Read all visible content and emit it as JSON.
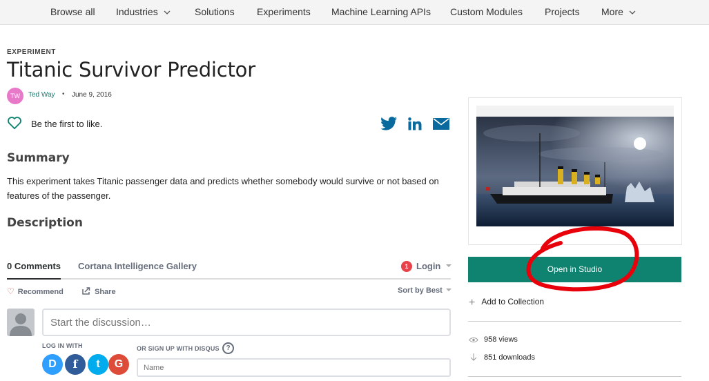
{
  "nav": {
    "items": [
      {
        "label": "Browse all"
      },
      {
        "label": "Industries"
      },
      {
        "label": "Solutions"
      },
      {
        "label": "Experiments"
      },
      {
        "label": "Machine Learning APIs"
      },
      {
        "label": "Custom Modules"
      },
      {
        "label": "Projects"
      },
      {
        "label": "More"
      }
    ]
  },
  "header": {
    "eyebrow": "EXPERIMENT",
    "title": "Titanic Survivor Predictor",
    "avatar_initials": "TW",
    "author": "Ted Way",
    "separator": "•",
    "date": "June 9, 2016"
  },
  "like": {
    "text": "Be the first to like."
  },
  "share": {
    "icons": [
      "twitter-icon",
      "linkedin-icon",
      "mail-icon"
    ]
  },
  "summary": {
    "heading": "Summary",
    "body": "This experiment takes Titanic passenger data and predicts whether somebody would survive or not based on features of the passenger."
  },
  "description": {
    "heading": "Description"
  },
  "comments": {
    "tab_comments": "0 Comments",
    "tab_gallery": "Cortana Intelligence Gallery",
    "login_badge": "1",
    "login": "Login",
    "recommend": "Recommend",
    "share": "Share",
    "sort": "Sort by Best",
    "input_placeholder": "Start the discussion…",
    "log_in_with": "LOG IN WITH",
    "or_sign_up": "OR SIGN UP WITH DISQUS",
    "help": "?",
    "social": [
      "D",
      "f",
      "t",
      "G"
    ],
    "name_placeholder": "Name"
  },
  "sidebar": {
    "open_button": "Open in Studio",
    "add_collection": "Add to Collection",
    "views": "958 views",
    "downloads": "851 downloads"
  },
  "colors": {
    "accent": "#108370",
    "author_link": "#1a7a6f",
    "share_icons": "#0a6a9e",
    "annotation": "#e8000b",
    "avatar": "#e879c9"
  }
}
